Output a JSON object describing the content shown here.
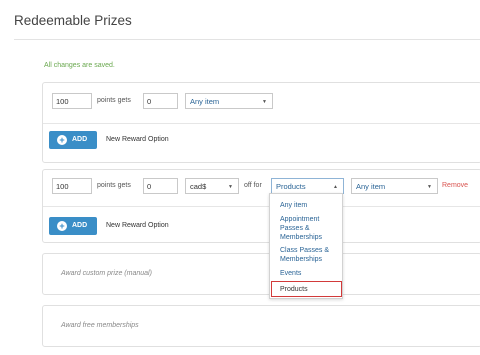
{
  "page": {
    "title": "Redeemable Prizes",
    "saved_message": "All changes are saved."
  },
  "reward1": {
    "points_value": "100",
    "points_label": "points gets",
    "gets_value": "0",
    "item_select": "Any item"
  },
  "add_section1": {
    "button_label": "ADD",
    "description": "New Reward Option"
  },
  "reward2": {
    "points_value": "100",
    "points_label": "points gets",
    "gets_value": "0",
    "currency_select": "cad$",
    "off_label": "off for",
    "category_select": "Products",
    "item_select": "Any item",
    "remove_label": "Remove"
  },
  "add_section2": {
    "button_label": "ADD",
    "description": "New Reward Option"
  },
  "custom_prize": {
    "label": "Award custom prize (manual)"
  },
  "free_memberships": {
    "label": "Award free memberships"
  },
  "dropdown": {
    "options": [
      {
        "line1": "Any item",
        "line2": "",
        "line3": ""
      },
      {
        "line1": "Appointment",
        "line2": "Passes &",
        "line3": "Memberships"
      },
      {
        "line1": "Class Passes &",
        "line2": "Memberships",
        "line3": ""
      },
      {
        "line1": "Events",
        "line2": "",
        "line3": ""
      },
      {
        "line1": "Products",
        "line2": "",
        "line3": ""
      }
    ],
    "selected": "Products"
  }
}
